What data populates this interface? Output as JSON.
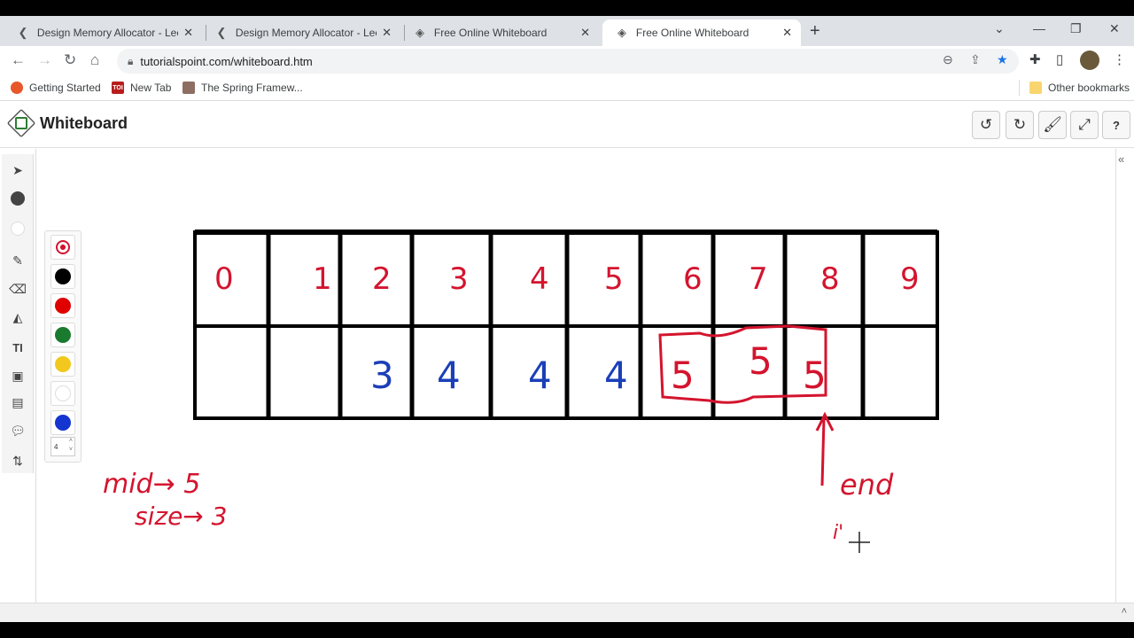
{
  "tabs": [
    {
      "title": "Design Memory Allocator - LeetC",
      "favicon": "leetcode-icon",
      "active": false
    },
    {
      "title": "Design Memory Allocator - LeetC",
      "favicon": "leetcode-icon",
      "active": false
    },
    {
      "title": "Free Online Whiteboard",
      "favicon": "whiteboard-icon",
      "active": false
    },
    {
      "title": "Free Online Whiteboard",
      "favicon": "whiteboard-icon",
      "active": true
    }
  ],
  "toolbar": {
    "url": "tutorialspoint.com/whiteboard.htm"
  },
  "bookmarks": {
    "items": [
      {
        "label": "Getting Started",
        "icon": "firefox-icon",
        "color": "#e8572a"
      },
      {
        "label": "New Tab",
        "icon": "toi-icon",
        "color": "#b71c1c"
      },
      {
        "label": "The Spring Framew...",
        "icon": "shield-icon",
        "color": "#8d6e63"
      }
    ],
    "other": "Other bookmarks"
  },
  "app": {
    "title": "Whiteboard"
  },
  "palette": {
    "colors": [
      "#000000",
      "#e00000",
      "#1a7a2e",
      "#f2c81e",
      "#ffffff",
      "#1535d0"
    ],
    "size": "4"
  },
  "drawing": {
    "index_row": [
      "0",
      "1",
      "2",
      "3",
      "4",
      "5",
      "6",
      "7",
      "8",
      "9"
    ],
    "value_row": [
      "",
      "",
      "3",
      "4",
      "4",
      "4",
      "5",
      "5",
      "5",
      ""
    ],
    "notes": {
      "mid": "mid→ 5",
      "size": "size→ 3",
      "end": "end",
      "i": "i'"
    },
    "colors": {
      "red": "#d4142e",
      "blue": "#1a3fb8",
      "black": "#000000"
    }
  }
}
